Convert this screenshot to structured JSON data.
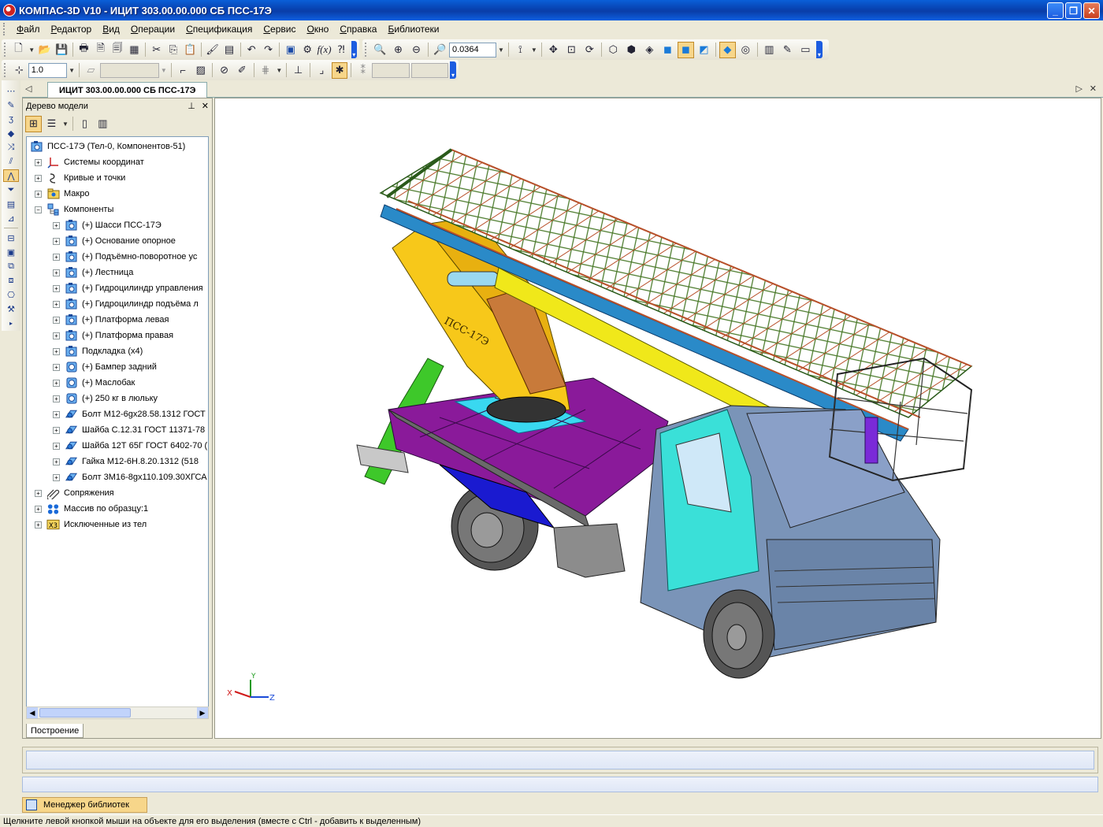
{
  "window": {
    "title": "КОМПАС-3D V10 - ИЦИТ 303.00.00.000 СБ ПСС-17Э",
    "buttons": [
      "minimize-icon",
      "restore-icon",
      "close-icon"
    ]
  },
  "menu": {
    "items": [
      "Файл",
      "Редактор",
      "Вид",
      "Операции",
      "Спецификация",
      "Сервис",
      "Окно",
      "Справка",
      "Библиотеки"
    ]
  },
  "toolbar": {
    "zoom_value": "0.0364",
    "step_value": "1.0"
  },
  "document_tab": {
    "label": "ИЦИТ 303.00.00.000 СБ ПСС-17Э"
  },
  "tree_panel": {
    "title": "Дерево модели",
    "footer_tab": "Построение",
    "root": "ПСС-17Э (Тел-0, Компонентов-51)",
    "top_items": [
      {
        "label": "Системы координат",
        "icon": "coordinate-system-icon"
      },
      {
        "label": "Кривые и точки",
        "icon": "curves-icon"
      },
      {
        "label": "Макро",
        "icon": "macro-folder-icon"
      },
      {
        "label": "Компоненты",
        "icon": "components-icon"
      }
    ],
    "components": [
      {
        "label": "(+) Шасси ПСС-17Э",
        "icon": "assembly-icon"
      },
      {
        "label": "(+) Основание опорное",
        "icon": "assembly-icon"
      },
      {
        "label": "(+) Подъёмно-поворотное  ус",
        "icon": "assembly-icon"
      },
      {
        "label": "(+) Лестница",
        "icon": "assembly-icon"
      },
      {
        "label": "(+) Гидроцилиндр управления",
        "icon": "assembly-icon"
      },
      {
        "label": "(+) Гидроцилиндр   подъёма л",
        "icon": "assembly-icon"
      },
      {
        "label": "(+) Платформа левая",
        "icon": "assembly-icon"
      },
      {
        "label": "(+) Платформа правая",
        "icon": "assembly-icon"
      },
      {
        "label": "Подкладка (x4)",
        "icon": "assembly-icon"
      },
      {
        "label": "(+) Бампер задний",
        "icon": "part-icon"
      },
      {
        "label": "(+) Маслобак",
        "icon": "part-icon"
      },
      {
        "label": "(+) 250 кг в люльку",
        "icon": "part-icon"
      },
      {
        "label": "Болт М12-6gx28.58.1312 ГОСТ",
        "icon": "standard-part-icon"
      },
      {
        "label": "Шайба С.12.31 ГОСТ 11371-78",
        "icon": "standard-part-icon"
      },
      {
        "label": "Шайба 12Т 65Г ГОСТ 6402-70 (",
        "icon": "standard-part-icon"
      },
      {
        "label": "Гайка  М12-6Н.8.20.1312 (518",
        "icon": "standard-part-icon"
      },
      {
        "label": "Болт 3М16-8gx110.109.30ХГСА",
        "icon": "standard-part-icon"
      }
    ],
    "bottom_items": [
      {
        "label": "Сопряжения",
        "icon": "mates-icon"
      },
      {
        "label": "Массив по образцу:1",
        "icon": "pattern-icon"
      },
      {
        "label": "Исключенные из тел",
        "icon": "excluded-icon"
      }
    ]
  },
  "viewport": {
    "axis_labels": {
      "x": "X",
      "y": "Y",
      "z": "Z"
    },
    "model_marking": "ПСС-17Э"
  },
  "library_manager_tab": "Менеджер библиотек",
  "status_text": "Щелкните левой кнопкой мыши на объекте для его выделения (вместе с Ctrl - добавить к выделенным)"
}
